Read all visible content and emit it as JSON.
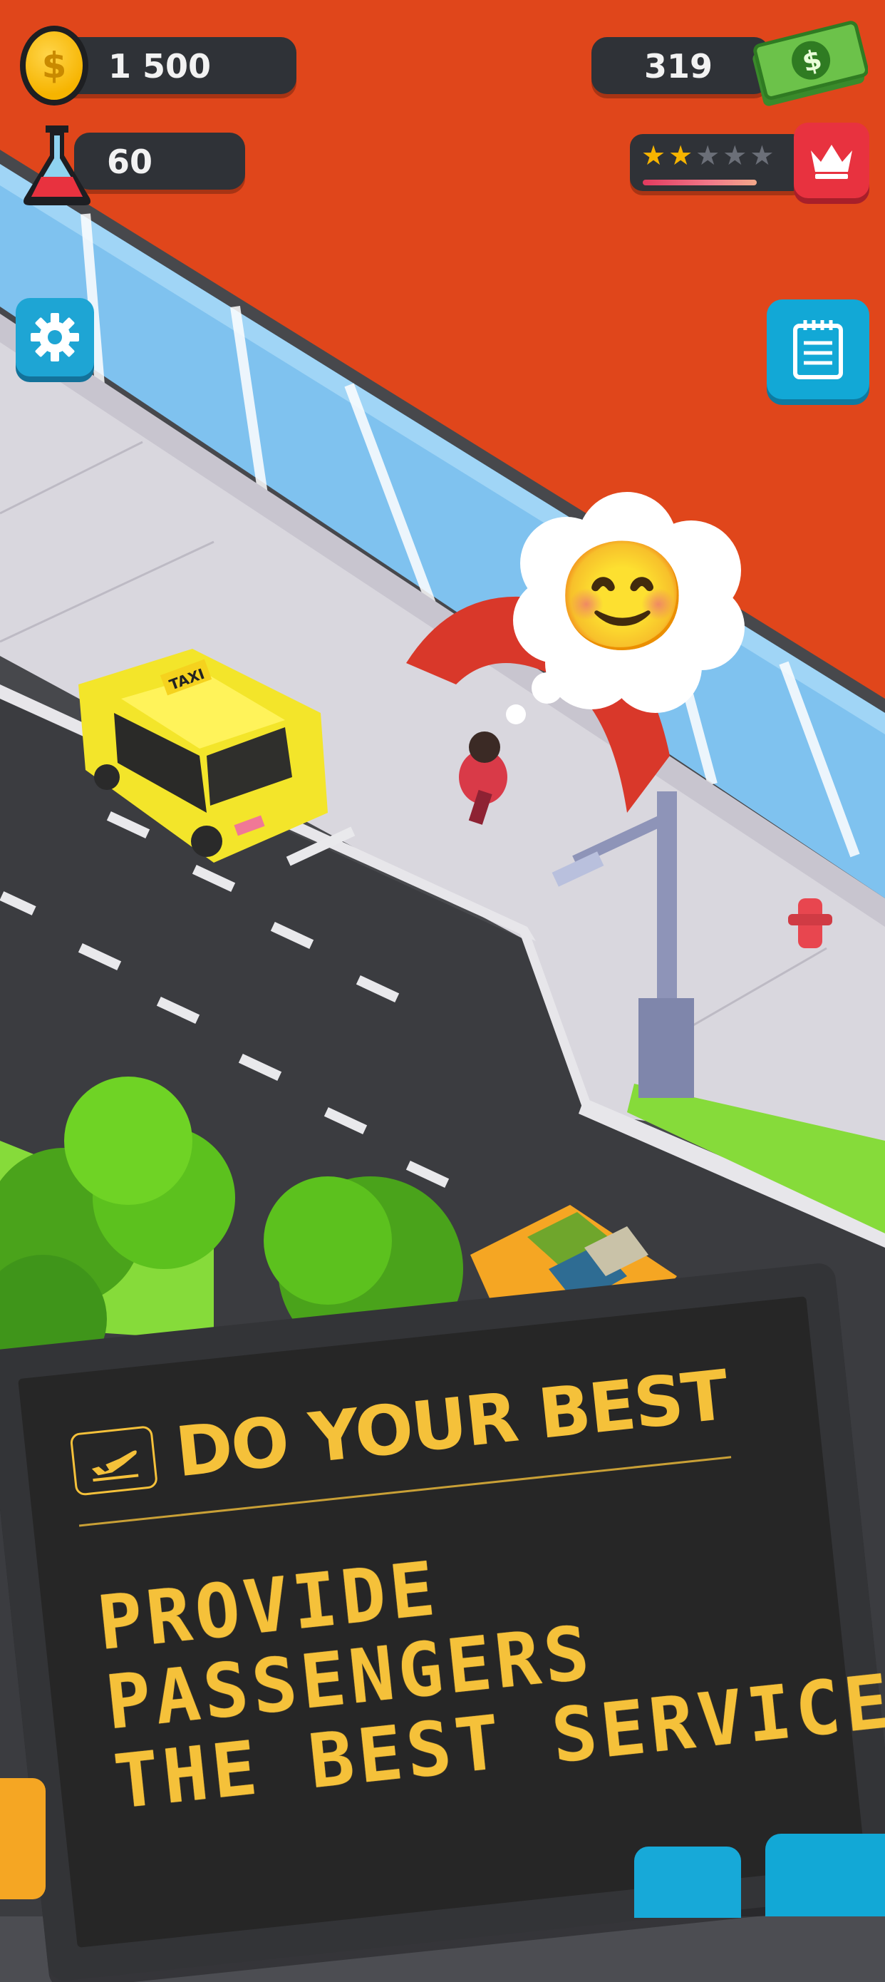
{
  "hud": {
    "coins": "1 500",
    "science": "60",
    "cash": "319",
    "rating": {
      "stars_filled": 2,
      "stars_total": 5
    }
  },
  "icons": {
    "coin": "coin-icon",
    "science": "flask-icon",
    "cash": "cash-icon",
    "crown": "crown-icon",
    "settings": "gear-icon",
    "tasks": "notepad-icon",
    "plane": "airplane-departure-icon",
    "bubble_emoji": "😊"
  },
  "panel": {
    "title": "DO YOUR BEST",
    "message_lines": [
      "PROVIDE",
      "PASSENGERS",
      "THE BEST SERVICE"
    ]
  },
  "scene": {
    "taxi_sign": "TAXI"
  },
  "colors": {
    "terminal_roof": "#e0461b",
    "accent_yellow": "#f5c13a",
    "button_blue": "#12a8d6",
    "crown_red": "#e8323f"
  }
}
